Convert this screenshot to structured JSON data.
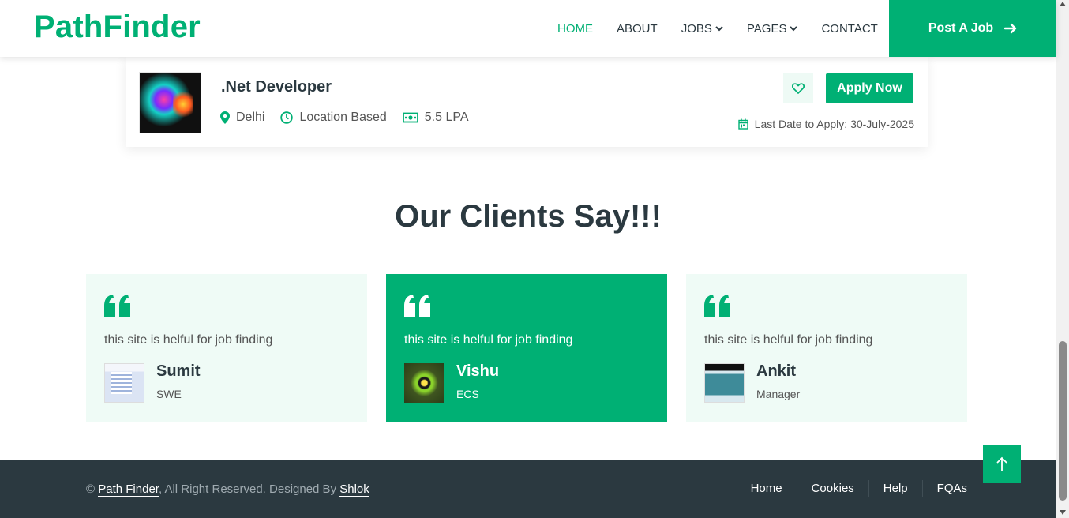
{
  "brand": "PathFinder",
  "colors": {
    "accent": "#00b074",
    "dark": "#2b3940",
    "light_bg": "#effbf6"
  },
  "nav": {
    "home": "HOME",
    "about": "ABOUT",
    "jobs": "JOBS",
    "pages": "PAGES",
    "contact": "CONTACT",
    "post_job": "Post A Job"
  },
  "job": {
    "title": ".Net Developer",
    "location": "Delhi",
    "type": "Location Based",
    "salary": "5.5 LPA",
    "apply_label": "Apply Now",
    "deadline": "Last Date to Apply: 30-July-2025"
  },
  "section_title": "Our Clients Say!!!",
  "testimonials": [
    {
      "text": "this site is helful for job finding",
      "name": "Sumit",
      "role": "SWE"
    },
    {
      "text": "this site is helful for job finding",
      "name": "Vishu",
      "role": "ECS"
    },
    {
      "text": "this site is helful for job finding",
      "name": "Ankit",
      "role": "Manager"
    }
  ],
  "footer": {
    "copy_symbol": "©",
    "site_link": "Path Finder",
    "rights_text": ", All Right Reserved. Designed By",
    "designer_link": "Shlok",
    "links": [
      "Home",
      "Cookies",
      "Help",
      "FQAs"
    ]
  },
  "icons": [
    "chevron-down-icon",
    "arrow-right-icon",
    "map-marker-icon",
    "clock-icon",
    "money-icon",
    "heart-icon",
    "calendar-icon",
    "quote-icon",
    "arrow-up-icon"
  ]
}
